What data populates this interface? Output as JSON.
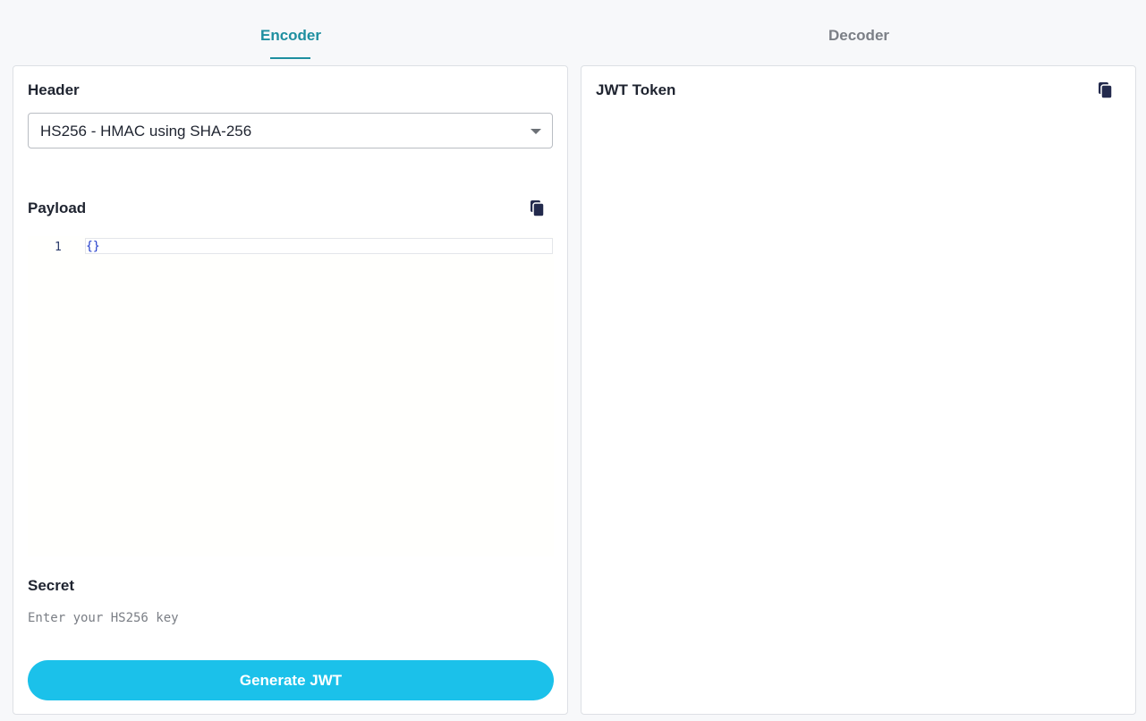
{
  "tabs": {
    "encoder": "Encoder",
    "decoder": "Decoder",
    "active": "Encoder"
  },
  "encoder": {
    "header_title": "Header",
    "algorithm_selected": "HS256 - HMAC using SHA-256",
    "payload_title": "Payload",
    "payload_lines": [
      {
        "number": "1",
        "text": "{}"
      }
    ],
    "secret_title": "Secret",
    "secret_placeholder": "Enter your HS256 key",
    "secret_value": "",
    "generate_button": "Generate JWT"
  },
  "decoder_panel": {
    "token_title": "JWT Token",
    "token_value": ""
  },
  "icons": {
    "copy": "copy-icon"
  },
  "colors": {
    "accent": "#1e8fa0",
    "button": "#1bc1ea",
    "icon": "#232a4d"
  }
}
